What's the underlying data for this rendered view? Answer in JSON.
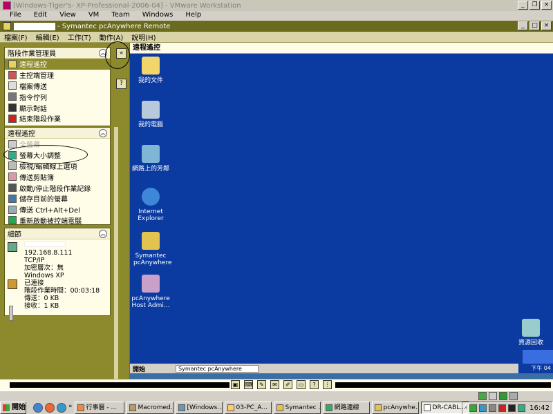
{
  "vm_window": {
    "title": "[Windows-Tiger's- XP-Professional-2006-04] - VMware Workstation",
    "menu": [
      "File",
      "Edit",
      "View",
      "VM",
      "Team",
      "Windows",
      "Help"
    ]
  },
  "pca_window": {
    "title": "- Symantec pcAnywhere Remote",
    "menu": [
      "檔案(F)",
      "編輯(E)",
      "工作(T)",
      "動作(A)",
      "說明(H)"
    ]
  },
  "session_manager": {
    "title": "階段作業管理員",
    "items": [
      {
        "label": "遠程遙控",
        "icon": "remote-control-icon",
        "selected": true
      },
      {
        "label": "主控端管理",
        "icon": "host-admin-icon"
      },
      {
        "label": "檔案傳送",
        "icon": "file-transfer-icon"
      },
      {
        "label": "指令佇列",
        "icon": "command-queue-icon"
      },
      {
        "label": "顯示對話",
        "icon": "chat-icon"
      },
      {
        "label": "結束階段作業",
        "icon": "end-session-icon"
      }
    ]
  },
  "remote_control": {
    "title": "遠程遙控",
    "items": [
      {
        "label": "全螢幕",
        "icon": "full-screen-icon",
        "disabled": true
      },
      {
        "label": "螢幕大小調整",
        "icon": "screen-scale-icon"
      },
      {
        "label": "檢視/編輯線上選項",
        "icon": "online-options-icon"
      },
      {
        "label": "傳送剪貼簿",
        "icon": "clipboard-icon"
      },
      {
        "label": "啟動/停止階段作業記錄",
        "icon": "session-record-icon"
      },
      {
        "label": "儲存目前的螢幕",
        "icon": "save-screen-icon"
      },
      {
        "label": "傳送 Ctrl+Alt+Del",
        "icon": "ctrl-alt-del-icon"
      },
      {
        "label": "重新啟動被控端電腦",
        "icon": "restart-host-icon"
      }
    ]
  },
  "details": {
    "title": "細節",
    "lines": [
      "192.168.8.111",
      "TCP/IP",
      "加密層次：無",
      "Windows XP",
      "已連接",
      "階段作業時間：00:03:18",
      "傳送：0 KB",
      "接收：1 KB"
    ]
  },
  "remote_header": "遠程遙控",
  "desktop_icons": [
    {
      "label": "我的文件",
      "icon": "my-documents-icon"
    },
    {
      "label": "我的電腦",
      "icon": "my-computer-icon"
    },
    {
      "label": "網路上的芳鄰",
      "icon": "network-places-icon"
    },
    {
      "label": "Internet Explorer",
      "icon": "internet-explorer-icon"
    },
    {
      "label": "Symantec pcAnywhere",
      "icon": "pcanywhere-icon"
    },
    {
      "label": "pcAnywhere Host Admi...",
      "icon": "host-admin-icon"
    },
    {
      "label": "資源回收",
      "icon": "recycle-bin-icon"
    }
  ],
  "remote_taskbar": {
    "start": "開始",
    "task": "Symantec pcAnywhere",
    "clock": "下午 04"
  },
  "host_taskbar": {
    "start": "開始",
    "tasks": [
      {
        "label": "行事曆 - ...",
        "icon": "calendar-icon"
      },
      {
        "label": "Macromed...",
        "icon": "macromedia-icon"
      },
      {
        "label": "[Windows...",
        "icon": "vmware-icon"
      },
      {
        "label": "03-PC_A...",
        "icon": "folder-icon"
      },
      {
        "label": "Symantec ...",
        "icon": "pcanywhere-icon"
      },
      {
        "label": "網路連線",
        "icon": "network-icon"
      },
      {
        "label": "pcAnywhe...",
        "icon": "pcanywhere-icon"
      },
      {
        "label": "DR-CABL...",
        "icon": "document-icon",
        "active": true
      }
    ],
    "clock": "16:42"
  },
  "colors": {
    "sidebar": "#8c8a2c",
    "desktop": "#0b3aa0",
    "panel": "#fffde8"
  }
}
